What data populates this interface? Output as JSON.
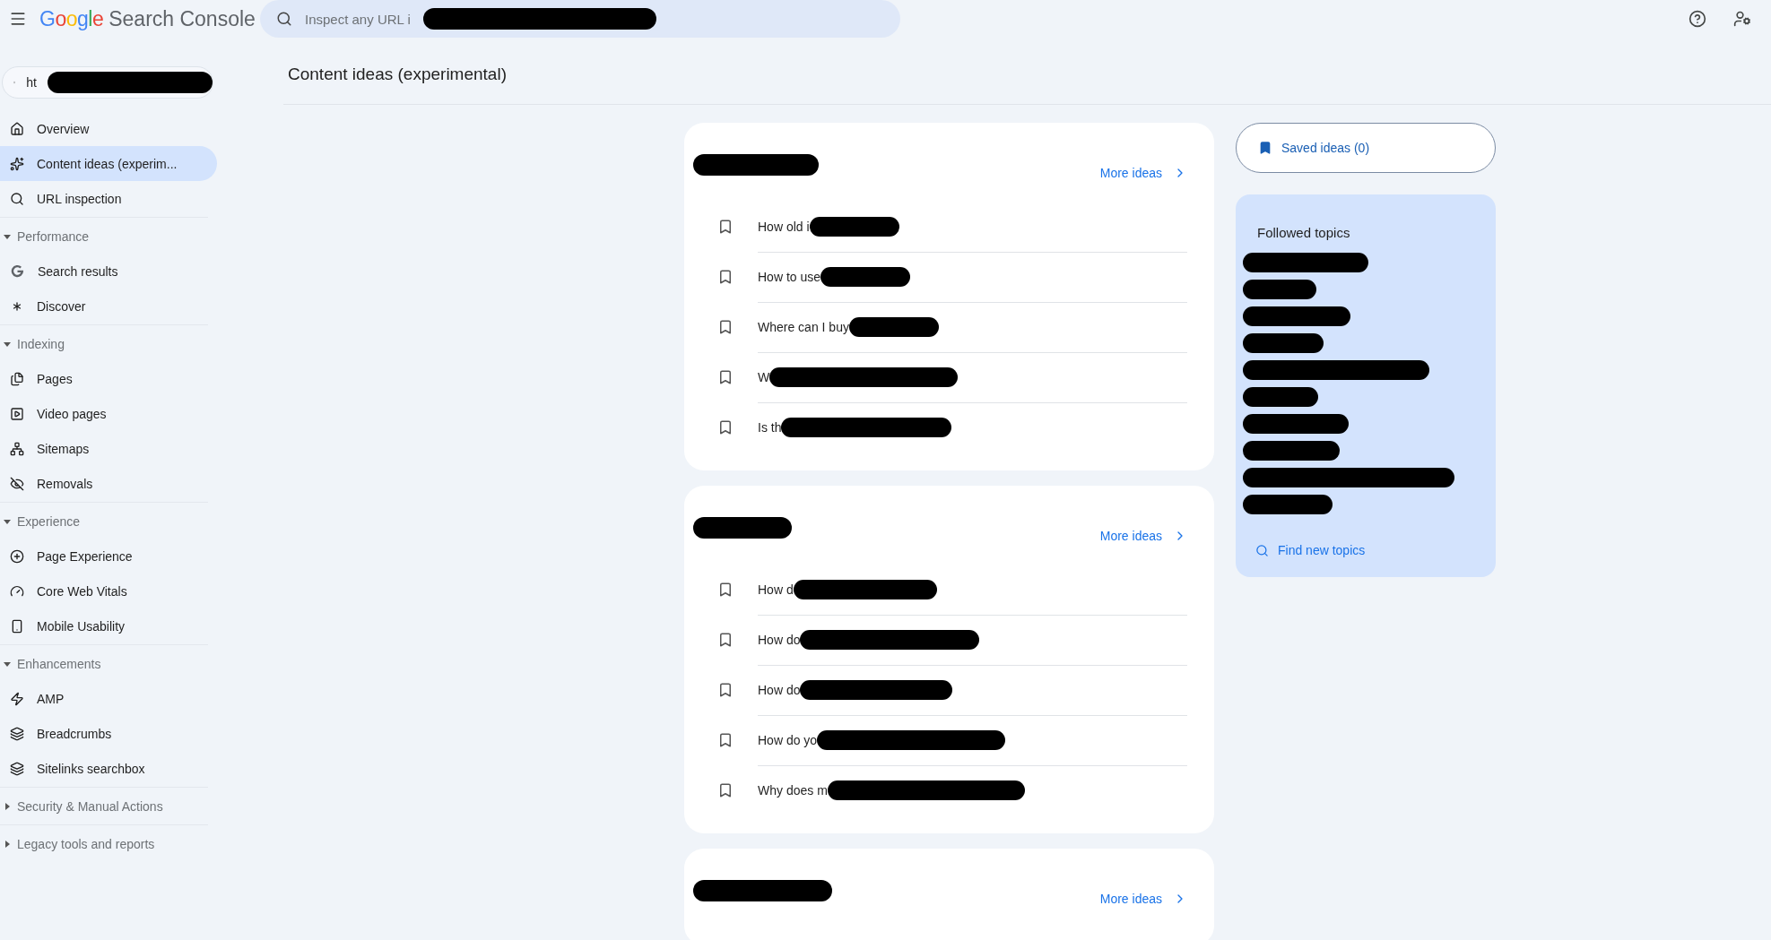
{
  "header": {
    "logo_brand": "Google",
    "logo_product": "Search Console",
    "search": {
      "placeholder": "Inspect any URL i"
    }
  },
  "property": {
    "value": "ht"
  },
  "sidebar": {
    "items": [
      {
        "label": "Overview",
        "selected": false
      },
      {
        "label": "Content ideas (experim...",
        "selected": true
      },
      {
        "label": "URL inspection",
        "selected": false
      }
    ],
    "sections": [
      {
        "title": "Performance",
        "expanded": true,
        "items": [
          {
            "label": "Search results",
            "selected": false
          },
          {
            "label": "Discover",
            "selected": false
          }
        ]
      },
      {
        "title": "Indexing",
        "expanded": true,
        "items": [
          {
            "label": "Pages",
            "selected": false
          },
          {
            "label": "Video pages",
            "selected": false
          },
          {
            "label": "Sitemaps",
            "selected": false
          },
          {
            "label": "Removals",
            "selected": false
          }
        ]
      },
      {
        "title": "Experience",
        "expanded": true,
        "items": [
          {
            "label": "Page Experience",
            "selected": false
          },
          {
            "label": "Core Web Vitals",
            "selected": false
          },
          {
            "label": "Mobile Usability",
            "selected": false
          }
        ]
      },
      {
        "title": "Enhancements",
        "expanded": true,
        "items": [
          {
            "label": "AMP",
            "selected": false
          },
          {
            "label": "Breadcrumbs",
            "selected": false
          },
          {
            "label": "Sitelinks searchbox",
            "selected": false
          }
        ]
      },
      {
        "title": "Security & Manual Actions",
        "expanded": false
      },
      {
        "title": "Legacy tools and reports",
        "expanded": false
      }
    ]
  },
  "page_title": "Content ideas (experimental)",
  "cards": [
    {
      "more_link": "More ideas",
      "ideas": [
        {
          "text": "How old i",
          "saved": false
        },
        {
          "text": "How to use",
          "saved": false
        },
        {
          "text": "Where can I buy",
          "saved": false
        },
        {
          "text": "W",
          "saved": false
        },
        {
          "text": "Is th",
          "saved": false
        }
      ]
    },
    {
      "more_link": "More ideas",
      "ideas": [
        {
          "text": "How d",
          "saved": false
        },
        {
          "text": "How do",
          "saved": false
        },
        {
          "text": "How do",
          "saved": false
        },
        {
          "text": "How do yo",
          "saved": false
        },
        {
          "text": "Why does m",
          "saved": false
        }
      ]
    },
    {
      "more_link": "More ideas"
    }
  ],
  "saved_ideas": {
    "label": "Saved ideas (0)"
  },
  "followed_topics": {
    "title": "Followed topics",
    "find_link": "Find new topics"
  }
}
